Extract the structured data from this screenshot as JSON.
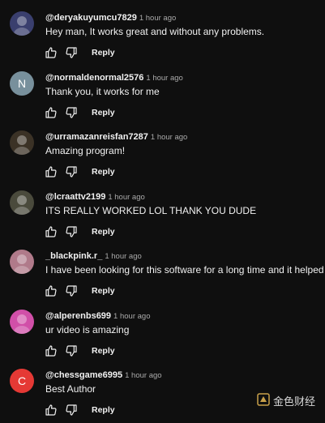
{
  "icons": {
    "like": "thumbs-up-icon",
    "dislike": "thumbs-down-icon"
  },
  "colors": {
    "background": "#0f0f0f",
    "text": "#f1f1f1",
    "secondary": "#aaaaaa"
  },
  "comments": [
    {
      "author": "@deryakuyumcu7829",
      "time": "1 hour ago",
      "text": "Hey man, It works great and without any problems.",
      "reply": "Reply",
      "avatar_letter": "",
      "avatar_color": "#3a3f6e"
    },
    {
      "author": "@normaldenormal2576",
      "time": "1 hour ago",
      "text": "Thank you, it works for me",
      "reply": "Reply",
      "avatar_letter": "N",
      "avatar_color": "#78909c"
    },
    {
      "author": "@urramazanreisfan7287",
      "time": "1 hour ago",
      "text": "Amazing program!",
      "reply": "Reply",
      "avatar_letter": "",
      "avatar_color": "#3b3226"
    },
    {
      "author": "@lcraattv2199",
      "time": "1 hour ago",
      "text": "ITS REALLY WORKED LOL THANK YOU DUDE",
      "reply": "Reply",
      "avatar_letter": "",
      "avatar_color": "#4a4a3c"
    },
    {
      "author": "_blackpink.r_",
      "time": "1 hour ago",
      "text": "I have been looking for this software for a long time and it helped me",
      "reply": "Reply",
      "avatar_letter": "",
      "avatar_color": "#b07a8a"
    },
    {
      "author": "@alperenbs699",
      "time": "1 hour ago",
      "text": "ur video is amazing",
      "reply": "Reply",
      "avatar_letter": "",
      "avatar_color": "#d14fa8"
    },
    {
      "author": "@chessgame6995",
      "time": "1 hour ago",
      "text": "Best Author",
      "reply": "Reply",
      "avatar_letter": "C",
      "avatar_color": "#e53935"
    }
  ],
  "watermark": {
    "text": "金色财经"
  }
}
